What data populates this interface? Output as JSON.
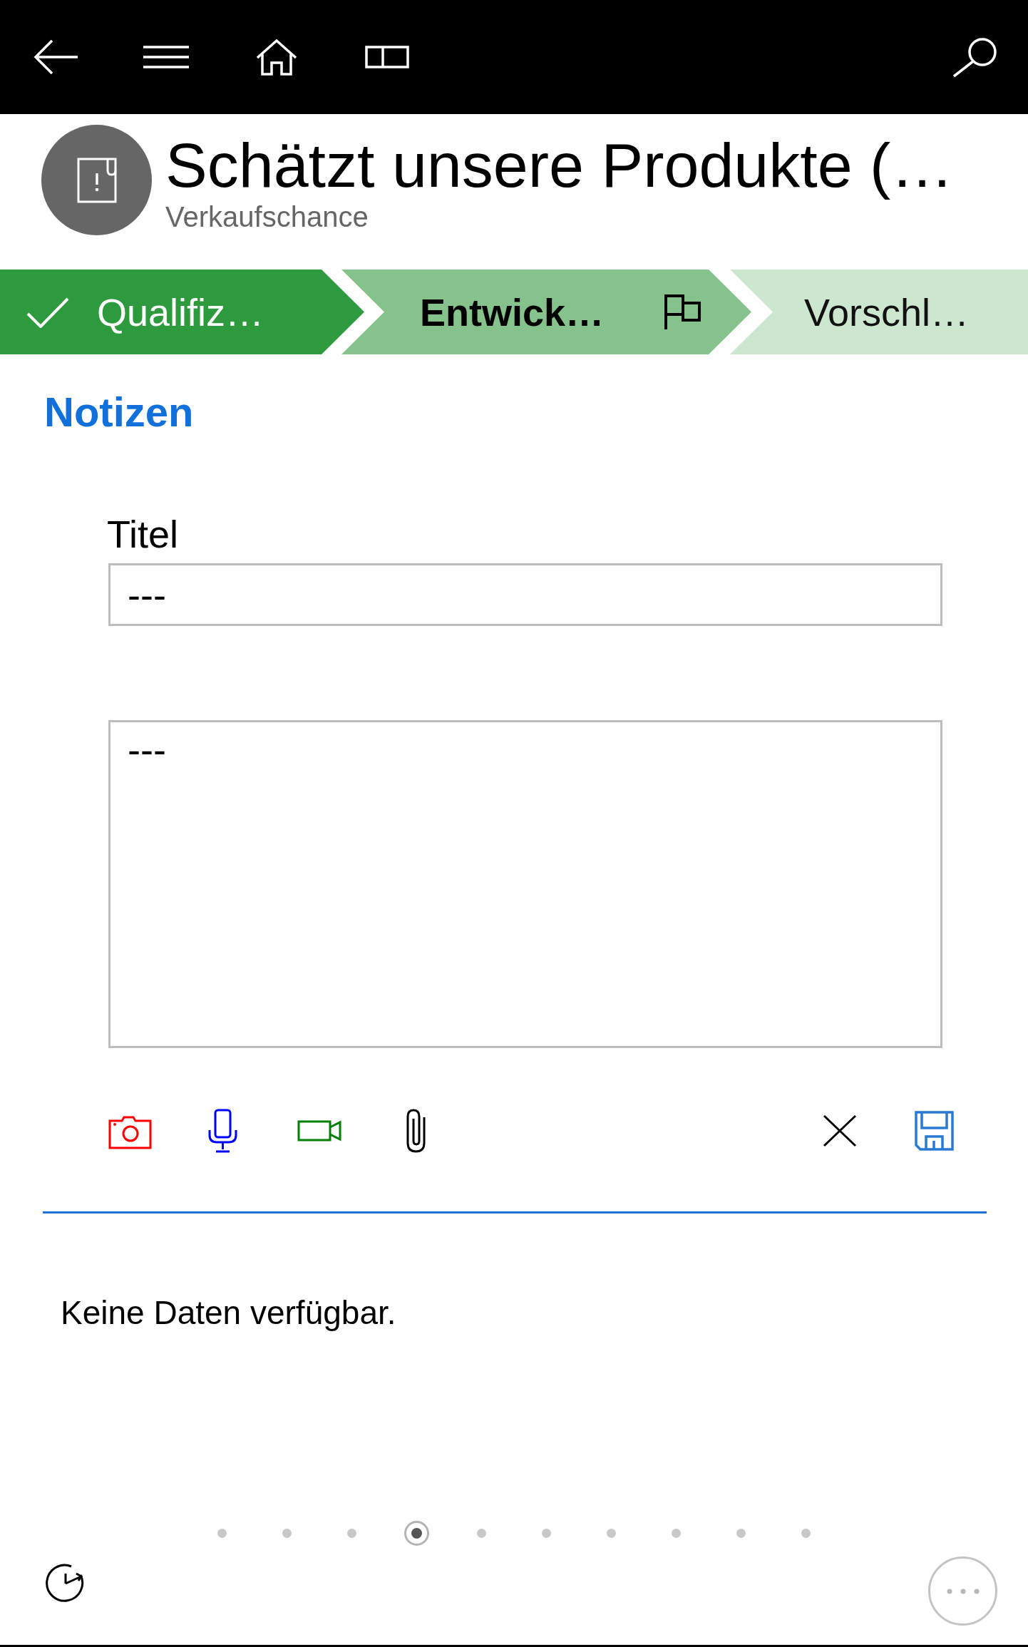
{
  "record": {
    "title": "Schätzt unsere Produkte (…",
    "entity": "Verkaufschance"
  },
  "stages": [
    {
      "label": "Qualifiz…",
      "completed": true,
      "selected": false
    },
    {
      "label": "Entwick…",
      "completed": false,
      "selected": true
    },
    {
      "label": "Vorschl…",
      "completed": false,
      "selected": false
    }
  ],
  "notes": {
    "heading": "Notizen",
    "title_label": "Titel",
    "title_value": "---",
    "body_value": "---",
    "empty_message": "Keine Daten verfügbar."
  },
  "pager": {
    "pages": [
      {
        "selected": false
      },
      {
        "selected": false
      },
      {
        "selected": false
      },
      {
        "selected": true
      },
      {
        "selected": false
      },
      {
        "selected": false
      },
      {
        "selected": false
      },
      {
        "selected": false
      },
      {
        "selected": false
      },
      {
        "selected": false
      }
    ]
  }
}
